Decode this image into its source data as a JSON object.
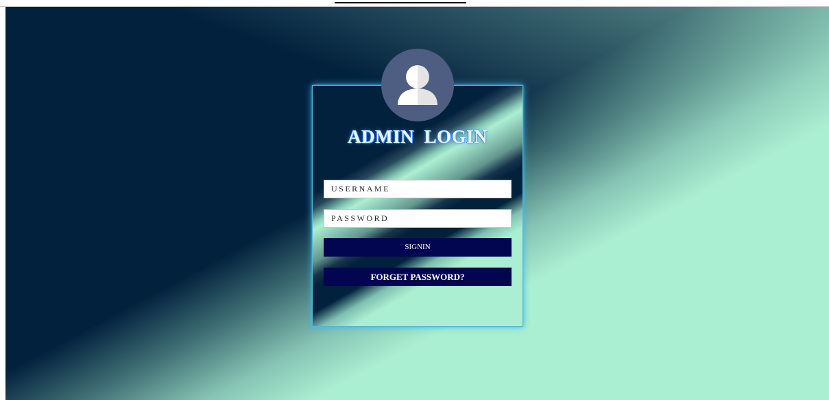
{
  "login": {
    "title": "ADMIN  LOGIN",
    "username": {
      "placeholder": "USERNAME",
      "value": ""
    },
    "password": {
      "placeholder": "PASSWORD",
      "value": ""
    },
    "signin_label": "SIGNIN",
    "forget_label": "FORGET PASSWORD?"
  },
  "icons": {
    "avatar": "user-icon"
  },
  "colors": {
    "dark_navy": "#02213d",
    "mint": "#abefd2",
    "button": "#020550",
    "avatar_bg": "#4e5d82",
    "card_glow": "#4fb7d9"
  }
}
